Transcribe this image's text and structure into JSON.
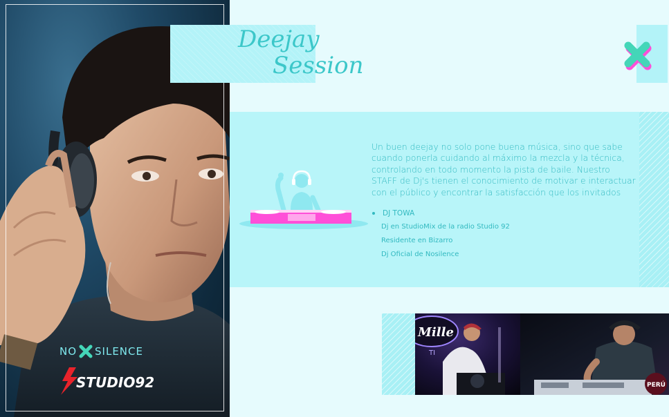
{
  "title": {
    "line1": "Deejay",
    "line2": "Session"
  },
  "description": "Un buen deejay no solo pone buena música, sino que sabe cuando ponerla cuidando al máximo la mezcla y la técnica, controlando en todo momento la pista de baile. Nuestro STAFF de Dj's tienen el conocimiento de motivar e interactuar con el público y encontrar la satisfacción que los invitados",
  "dj": {
    "name": "DJ TOWA",
    "details": [
      "Dj en StudioMix de la radio Studio 92",
      "Residente en Bizarro",
      "Dj Oficial de Nosilence"
    ]
  },
  "logos": {
    "nosilence_left": "NO",
    "nosilence_right": "SILENCE",
    "studio": "STUDIO92"
  },
  "photos": {
    "photo1_sign": "Mille",
    "photo1_sub": "TI",
    "photo2_badge": "PERÚ"
  },
  "colors": {
    "accent": "#32b9c0",
    "panel": "#b8f5f9",
    "background": "#e6fbfd",
    "magenta": "#ff4fd8",
    "studio_red": "#e8232b"
  },
  "icons": [
    "x-mark-icon",
    "dj-turntable-illustration"
  ]
}
